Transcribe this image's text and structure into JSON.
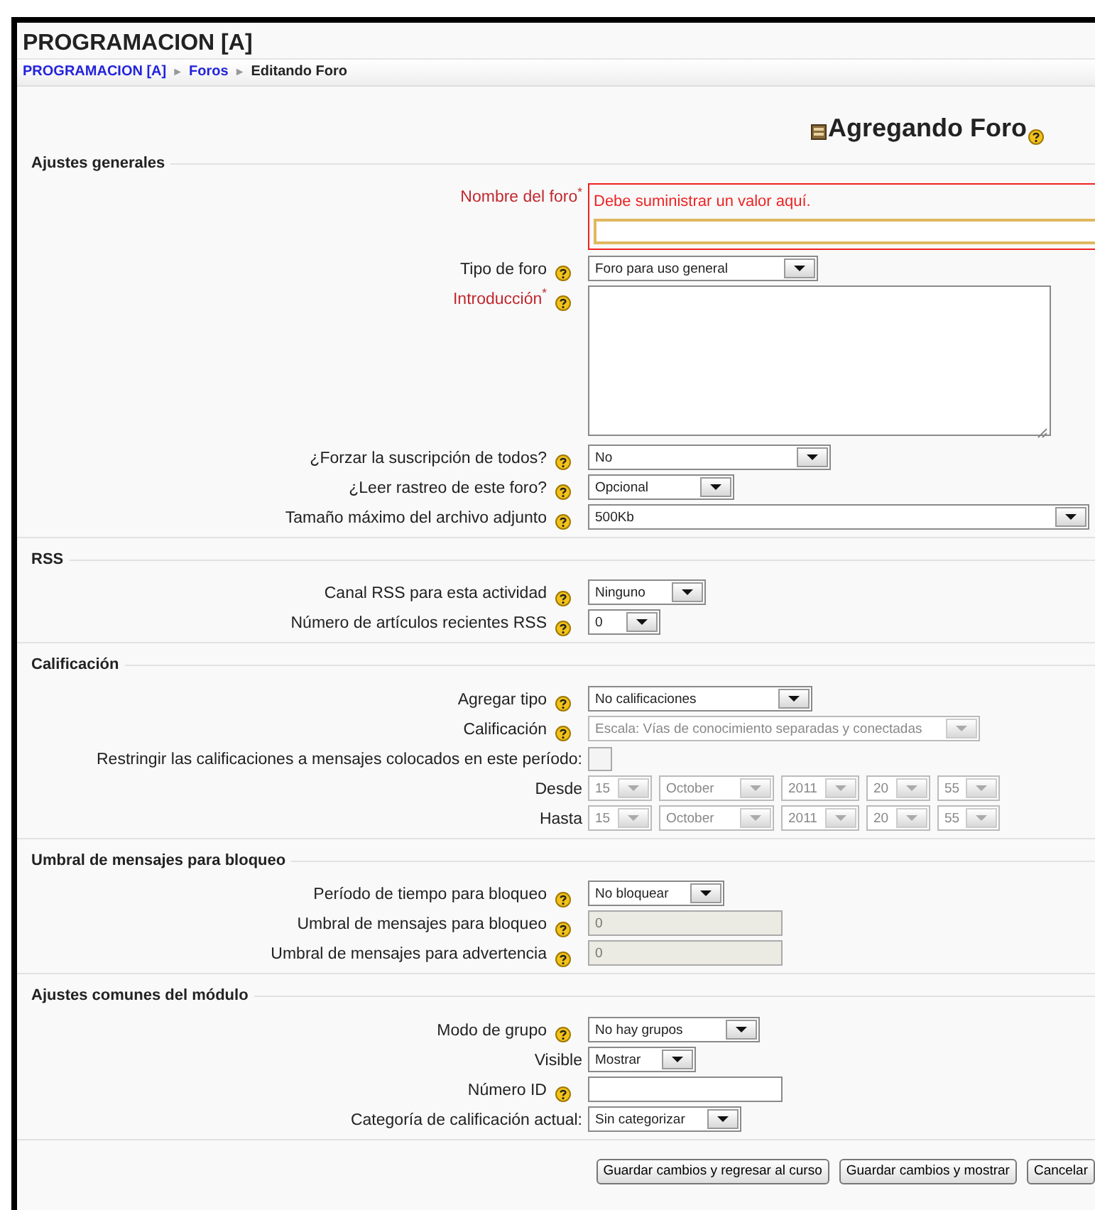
{
  "course_title": "PROGRAMACION [A]",
  "breadcrumb": [
    {
      "kind": "link",
      "text": "PROGRAMACION [A]"
    },
    {
      "kind": "separator",
      "text": "►"
    },
    {
      "kind": "link",
      "text": "Foros"
    },
    {
      "kind": "separator",
      "text": "►"
    },
    {
      "kind": "current",
      "text": "Editando Foro"
    }
  ],
  "page_title": "Agregando Foro",
  "sections": [
    {
      "legend": "Ajustes generales",
      "fields": [
        {
          "kind": "text",
          "label": "Nombre del foro$^{*}$",
          "required": true,
          "help": false,
          "error": "Debe suministrar un valor aquí.",
          "disabled": false
        },
        {
          "kind": "select",
          "label": "Tipo de foro",
          "required": false,
          "help": true,
          "value": "Foro para uso general",
          "disabled": false
        },
        {
          "kind": "textarea",
          "label": "Introducción$^{*}$",
          "required": true,
          "help": true,
          "disabled": false
        },
        {
          "kind": "select",
          "label": "¿Forzar la suscripción de todos?",
          "required": false,
          "help": true,
          "value": "No",
          "disabled": false
        },
        {
          "kind": "select",
          "label": "¿Leer rastreo de este foro?",
          "required": false,
          "help": true,
          "value": "Opcional",
          "disabled": false
        },
        {
          "kind": "select",
          "label": "Tamaño máximo del archivo adjunto",
          "required": false,
          "help": true,
          "value": "500Kb",
          "disabled": false
        }
      ]
    },
    {
      "legend": "RSS",
      "fields": [
        {
          "kind": "select",
          "label": "Canal RSS para esta actividad",
          "required": false,
          "help": true,
          "value": "Ninguno",
          "disabled": false
        },
        {
          "kind": "select",
          "label": "Número de artículos recientes RSS",
          "required": false,
          "help": true,
          "value": "0",
          "disabled": false
        }
      ]
    },
    {
      "legend": "Calificación",
      "fields": [
        {
          "kind": "select",
          "label": "Agregar tipo",
          "required": false,
          "help": true,
          "value": "No calificaciones",
          "disabled": false
        },
        {
          "kind": "select",
          "label": "Calificación",
          "required": false,
          "help": true,
          "value": "Escala: Vías de conocimiento separadas y conectadas",
          "disabled": true
        },
        {
          "kind": "checkbox",
          "label": "Restringir las calificaciones a mensajes colocados en este período:",
          "required": false,
          "help": false,
          "checked": false,
          "disabled": true
        },
        {
          "kind": "date",
          "label": "Desde",
          "required": false,
          "help": false,
          "parts": [
            "15",
            "October",
            "2011",
            "20",
            "55"
          ],
          "disabled": true
        },
        {
          "kind": "date",
          "label": "Hasta",
          "required": false,
          "help": false,
          "parts": [
            "15",
            "October",
            "2011",
            "20",
            "55"
          ],
          "disabled": true
        }
      ]
    },
    {
      "legend": "Umbral de mensajes para bloqueo",
      "fields": [
        {
          "kind": "select",
          "label": "Período de tiempo para bloqueo",
          "required": false,
          "help": true,
          "value": "No bloquear",
          "disabled": false
        },
        {
          "kind": "text",
          "label": "Umbral de mensajes para bloqueo",
          "required": false,
          "help": true,
          "value": "0",
          "disabled": true
        },
        {
          "kind": "text",
          "label": "Umbral de mensajes para advertencia",
          "required": false,
          "help": true,
          "value": "0",
          "disabled": true
        }
      ]
    },
    {
      "legend": "Ajustes comunes del módulo",
      "fields": [
        {
          "kind": "select",
          "label": "Modo de grupo",
          "required": false,
          "help": true,
          "value": "No hay grupos",
          "disabled": false
        },
        {
          "kind": "select",
          "label": "Visible",
          "required": false,
          "help": false,
          "value": "Mostrar",
          "disabled": false
        },
        {
          "kind": "text",
          "label": "Número ID",
          "required": false,
          "help": true,
          "disabled": false
        },
        {
          "kind": "select",
          "label": "Categoría de calificación actual:",
          "required": false,
          "help": false,
          "value": "Sin categorizar",
          "disabled": false
        }
      ]
    }
  ],
  "buttons": [
    "Guardar cambios y regresar al curso",
    "Guardar cambios y mostrar",
    "Cancelar"
  ]
}
